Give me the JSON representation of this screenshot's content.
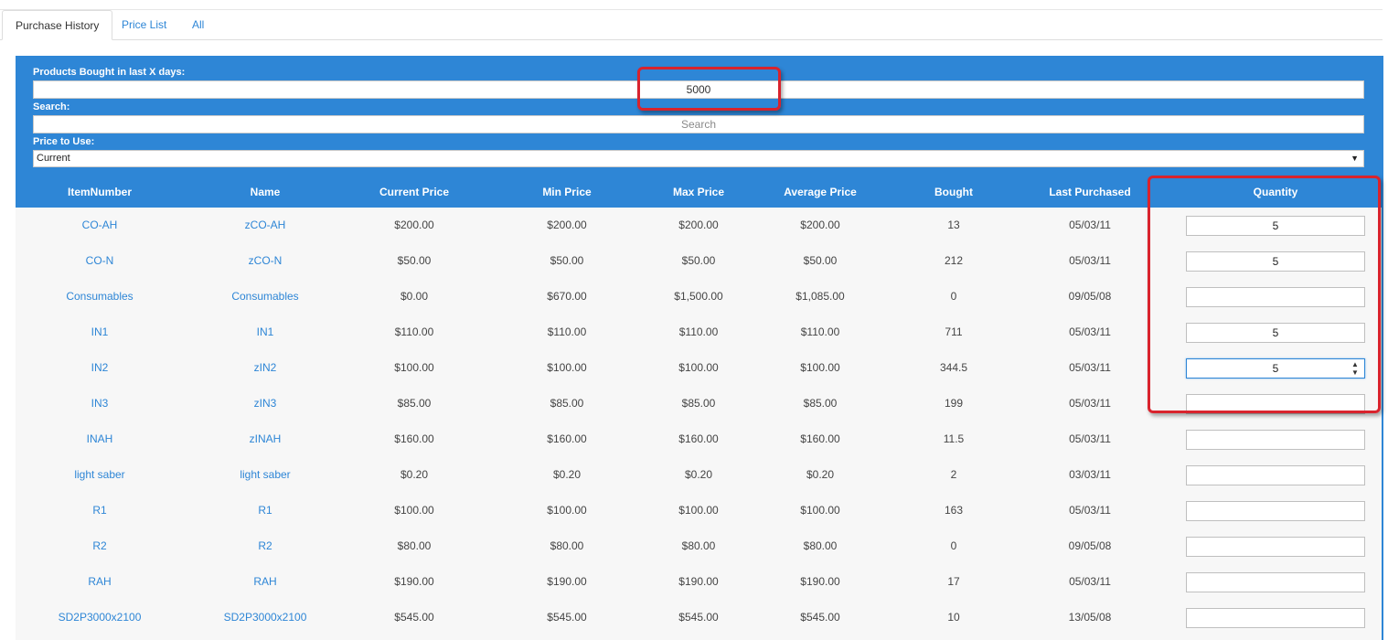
{
  "tabs": [
    {
      "label": "Purchase History",
      "active": true
    },
    {
      "label": "Price List",
      "active": false
    },
    {
      "label": "All",
      "active": false
    }
  ],
  "filters": {
    "days_label": "Products Bought in last X days:",
    "days_value": "5000",
    "search_label": "Search:",
    "search_placeholder": "Search",
    "price_label": "Price to Use:",
    "price_value": "Current"
  },
  "table": {
    "headers": [
      "ItemNumber",
      "Name",
      "Current Price",
      "Min Price",
      "Max Price",
      "Average Price",
      "Bought",
      "Last Purchased",
      "Quantity"
    ],
    "rows": [
      {
        "item": "CO-AH",
        "name": "zCO-AH",
        "current": "$200.00",
        "min": "$200.00",
        "max": "$200.00",
        "avg": "$200.00",
        "bought": "13",
        "last": "05/03/11",
        "qty": "5"
      },
      {
        "item": "CO-N",
        "name": "zCO-N",
        "current": "$50.00",
        "min": "$50.00",
        "max": "$50.00",
        "avg": "$50.00",
        "bought": "212",
        "last": "05/03/11",
        "qty": "5"
      },
      {
        "item": "Consumables",
        "name": "Consumables",
        "current": "$0.00",
        "min": "$670.00",
        "max": "$1,500.00",
        "avg": "$1,085.00",
        "bought": "0",
        "last": "09/05/08",
        "qty": ""
      },
      {
        "item": "IN1",
        "name": "IN1",
        "current": "$110.00",
        "min": "$110.00",
        "max": "$110.00",
        "avg": "$110.00",
        "bought": "711",
        "last": "05/03/11",
        "qty": "5"
      },
      {
        "item": "IN2",
        "name": "zIN2",
        "current": "$100.00",
        "min": "$100.00",
        "max": "$100.00",
        "avg": "$100.00",
        "bought": "344.5",
        "last": "05/03/11",
        "qty": "5"
      },
      {
        "item": "IN3",
        "name": "zIN3",
        "current": "$85.00",
        "min": "$85.00",
        "max": "$85.00",
        "avg": "$85.00",
        "bought": "199",
        "last": "05/03/11",
        "qty": ""
      },
      {
        "item": "INAH",
        "name": "zINAH",
        "current": "$160.00",
        "min": "$160.00",
        "max": "$160.00",
        "avg": "$160.00",
        "bought": "11.5",
        "last": "05/03/11",
        "qty": ""
      },
      {
        "item": "light saber",
        "name": "light saber",
        "current": "$0.20",
        "min": "$0.20",
        "max": "$0.20",
        "avg": "$0.20",
        "bought": "2",
        "last": "03/03/11",
        "qty": ""
      },
      {
        "item": "R1",
        "name": "R1",
        "current": "$100.00",
        "min": "$100.00",
        "max": "$100.00",
        "avg": "$100.00",
        "bought": "163",
        "last": "05/03/11",
        "qty": ""
      },
      {
        "item": "R2",
        "name": "R2",
        "current": "$80.00",
        "min": "$80.00",
        "max": "$80.00",
        "avg": "$80.00",
        "bought": "0",
        "last": "09/05/08",
        "qty": ""
      },
      {
        "item": "RAH",
        "name": "RAH",
        "current": "$190.00",
        "min": "$190.00",
        "max": "$190.00",
        "avg": "$190.00",
        "bought": "17",
        "last": "05/03/11",
        "qty": ""
      },
      {
        "item": "SD2P3000x2100",
        "name": "SD2P3000x2100",
        "current": "$545.00",
        "min": "$545.00",
        "max": "$545.00",
        "avg": "$545.00",
        "bought": "10",
        "last": "13/05/08",
        "qty": ""
      }
    ]
  },
  "colors": {
    "accent": "#2e86d6",
    "highlight": "#d9232d"
  }
}
